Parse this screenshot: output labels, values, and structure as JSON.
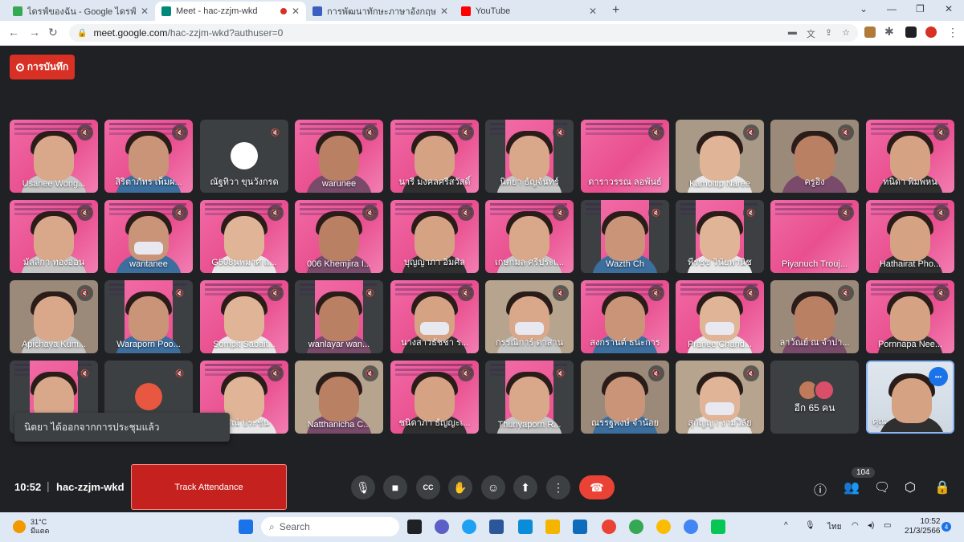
{
  "browser": {
    "tabs": [
      {
        "title": "ไดรฟ์ของฉัน - Google ไดรฟ์",
        "fav": "#34a853"
      },
      {
        "title": "Meet - hac-zzjm-wkd",
        "fav": "#00897b"
      },
      {
        "title": "การพัฒนาทักษะภาษาอังกฤษ English",
        "fav": "#3b5fc0"
      },
      {
        "title": "YouTube",
        "fav": "#ff0000"
      }
    ],
    "url_domain": "meet.google.com",
    "url_path": "/hac-zzjm-wkd?authuser=0"
  },
  "meet": {
    "record_label": "การบันทึก",
    "participants": [
      {
        "name": "Usanee Wong...",
        "style": "pink"
      },
      {
        "name": "สิริตาภัทร เพ็มผ...",
        "style": "pink"
      },
      {
        "name": "ณัฐทิวา ขุนวังกรด",
        "style": "gray-avatar"
      },
      {
        "name": "warunee",
        "style": "pink"
      },
      {
        "name": "นารี มงคลศรีสวัสดิ์",
        "style": "pink"
      },
      {
        "name": "นิตยา ธัญจันทร์",
        "style": "pink-narrow"
      },
      {
        "name": "ดาราวรรณ ลอพันธ์",
        "style": "pink-empty"
      },
      {
        "name": "Kamoltip Naree",
        "style": "photo"
      },
      {
        "name": "ครูอิง",
        "style": "photo"
      },
      {
        "name": "ทนิดา พิมพหน",
        "style": "pink"
      },
      {
        "name": "มัลลิกา ทองอ่อน",
        "style": "pink"
      },
      {
        "name": "wantanee",
        "style": "pink-mask"
      },
      {
        "name": "G508นพมาศ แ...",
        "style": "pink"
      },
      {
        "name": "006 Khemjira I...",
        "style": "pink"
      },
      {
        "name": "บุญญาภา อิ่มศิล",
        "style": "pink"
      },
      {
        "name": "เกษกมล ศรีประเ...",
        "style": "pink"
      },
      {
        "name": "Wazth Ch",
        "style": "pink-narrow"
      },
      {
        "name": "พีรชช วินัยพานิช",
        "style": "pink-narrow"
      },
      {
        "name": "Piyanuch Trouj...",
        "style": "pink-empty"
      },
      {
        "name": "Hathairat Pho...",
        "style": "pink"
      },
      {
        "name": "Apichaya Kum...",
        "style": "photo"
      },
      {
        "name": "Waraporn Poo...",
        "style": "pink-narrow"
      },
      {
        "name": "Sompit Sabait...",
        "style": "pink"
      },
      {
        "name": "wanlayar wan...",
        "style": "pink-narrow"
      },
      {
        "name": "นางสาวธัชชา ร...",
        "style": "pink-mask"
      },
      {
        "name": "กรรณิการ์ ดาสาน",
        "style": "photo-mask"
      },
      {
        "name": "สงกรานต์ ธนะการ",
        "style": "pink"
      },
      {
        "name": "Pranee Chand...",
        "style": "pink-mask"
      },
      {
        "name": "ลาวัณย์ ณ จำปา...",
        "style": "photo"
      },
      {
        "name": "Pornnapa Nee...",
        "style": "pink"
      },
      {
        "name": "",
        "style": "pink-narrow"
      },
      {
        "name": "",
        "style": "gray-red-avatar"
      },
      {
        "name": "...รณ์ ประชัน",
        "style": "pink"
      },
      {
        "name": "Natthanicha C...",
        "style": "photo"
      },
      {
        "name": "ชนิดาภา ธัญญะเ...",
        "style": "pink"
      },
      {
        "name": "Thunyaporn R...",
        "style": "pink-narrow"
      },
      {
        "name": "ณรรฐพงษ์ จำน้อย",
        "style": "photo"
      },
      {
        "name": "สุกัญญา งามวิลัย",
        "style": "photo-mask"
      },
      {
        "name": "อีก 65 คน",
        "style": "more"
      },
      {
        "name": "คุณ",
        "style": "self"
      }
    ],
    "toast": "นิตยา ได้ออกจากการประชุมแล้ว",
    "time": "10:52",
    "meeting_code": "hac-zzjm-wkd",
    "attendance_button": "Track Attendance",
    "participant_count": "104"
  },
  "taskbar": {
    "temperature": "31°C",
    "weather": "มีแดด",
    "search_placeholder": "Search",
    "language": "ไทย",
    "clock_time": "10:52",
    "clock_date": "21/3/2566",
    "notification_count": "4"
  }
}
